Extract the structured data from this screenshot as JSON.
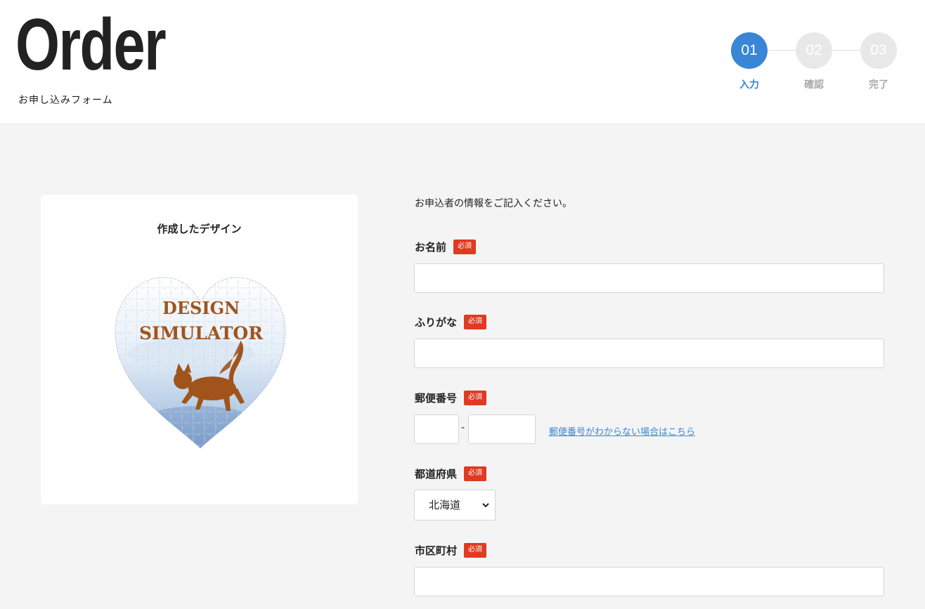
{
  "header": {
    "title": "Order",
    "subtitle": "お申し込みフォーム"
  },
  "steps": [
    {
      "number": "01",
      "label": "入力",
      "active": true
    },
    {
      "number": "02",
      "label": "確認",
      "active": false
    },
    {
      "number": "03",
      "label": "完了",
      "active": false
    }
  ],
  "design_card": {
    "title": "作成したデザイン",
    "image_text_line1": "DESIGN",
    "image_text_line2": "SIMULATOR"
  },
  "form": {
    "intro": "お申込者の情報をご記入ください。",
    "required_badge": "必須",
    "name_label": "お名前",
    "name_value": "",
    "furigana_label": "ふりがな",
    "furigana_value": "",
    "zip_label": "郵便番号",
    "zip_separator": "-",
    "zip_link": "郵便番号がわからない場合はこちら",
    "prefecture_label": "都道府県",
    "prefecture_selected": "北海道",
    "city_label": "市区町村",
    "city_value": ""
  },
  "colors": {
    "accent": "#3a86d6",
    "required": "#e03a22",
    "background": "#f4f4f4",
    "step_inactive": "#e8e8e8",
    "logo_brown": "#a0541c"
  },
  "icons": {
    "select_arrow": "chevron-down-icon",
    "cat": "cat-icon"
  }
}
